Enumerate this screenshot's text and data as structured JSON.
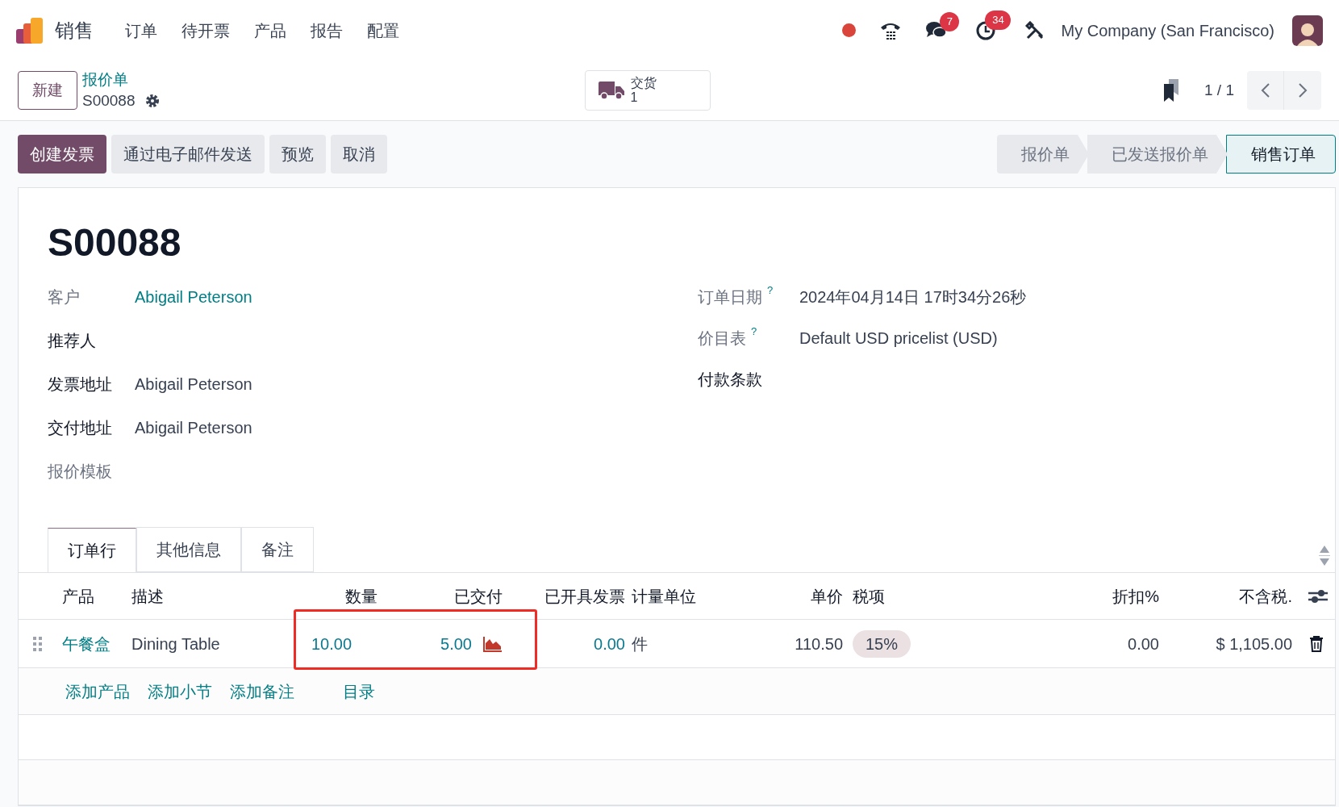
{
  "app": {
    "name": "销售",
    "menu": [
      "订单",
      "待开票",
      "产品",
      "报告",
      "配置"
    ]
  },
  "systray": {
    "chat_badge": "7",
    "activity_badge": "34",
    "company": "My Company (San Francisco)"
  },
  "control_panel": {
    "new_button": "新建",
    "breadcrumb": "报价单",
    "record": "S00088",
    "smart_button": {
      "label": "交货",
      "count": "1"
    },
    "pager": "1 / 1"
  },
  "actions": [
    {
      "label": "创建发票",
      "primary": true
    },
    {
      "label": "通过电子邮件发送",
      "primary": false
    },
    {
      "label": "预览",
      "primary": false
    },
    {
      "label": "取消",
      "primary": false
    }
  ],
  "statusbar": [
    {
      "label": "报价单",
      "selected": false
    },
    {
      "label": "已发送报价单",
      "selected": false
    },
    {
      "label": "销售订单",
      "selected": true
    }
  ],
  "form": {
    "title": "S00088",
    "left_fields": [
      {
        "label": "客户",
        "muted": true,
        "value": "Abigail Peterson",
        "kind": "link"
      },
      {
        "label": "推荐人",
        "muted": false
      },
      {
        "label": "发票地址",
        "muted": false,
        "value": "Abigail Peterson",
        "kind": "text"
      },
      {
        "label": "交付地址",
        "muted": false,
        "value": "Abigail Peterson",
        "kind": "text"
      },
      {
        "label": "报价模板",
        "muted": true
      }
    ],
    "right_fields": [
      {
        "label": "订单日期",
        "muted": true,
        "help": "?",
        "value": "2024年04月14日 17时34分26秒",
        "kind": "text"
      },
      {
        "label": "价目表",
        "muted": true,
        "help": "?",
        "value": "Default USD pricelist (USD)",
        "kind": "text"
      },
      {
        "label": "付款条款",
        "muted": false
      }
    ]
  },
  "tabs": [
    {
      "label": "订单行",
      "selected": true
    },
    {
      "label": "其他信息",
      "selected": false
    },
    {
      "label": "备注",
      "selected": false
    }
  ],
  "table": {
    "columns": [
      "产品",
      "描述",
      "数量",
      "已交付",
      "已开具发票",
      "计量单位",
      "单价",
      "税项",
      "折扣%",
      "不含税."
    ],
    "rows": [
      {
        "product": "午餐盒",
        "description": "Dining Table",
        "quantity": "10.00",
        "delivered": "5.00",
        "invoiced": "0.00",
        "uom": "件",
        "price": "110.50",
        "tax": "15%",
        "discount": "0.00",
        "subtotal": "$ 1,105.00"
      }
    ],
    "add_links": [
      "添加产品",
      "添加小节",
      "添加备注"
    ],
    "catalog": "目录"
  }
}
